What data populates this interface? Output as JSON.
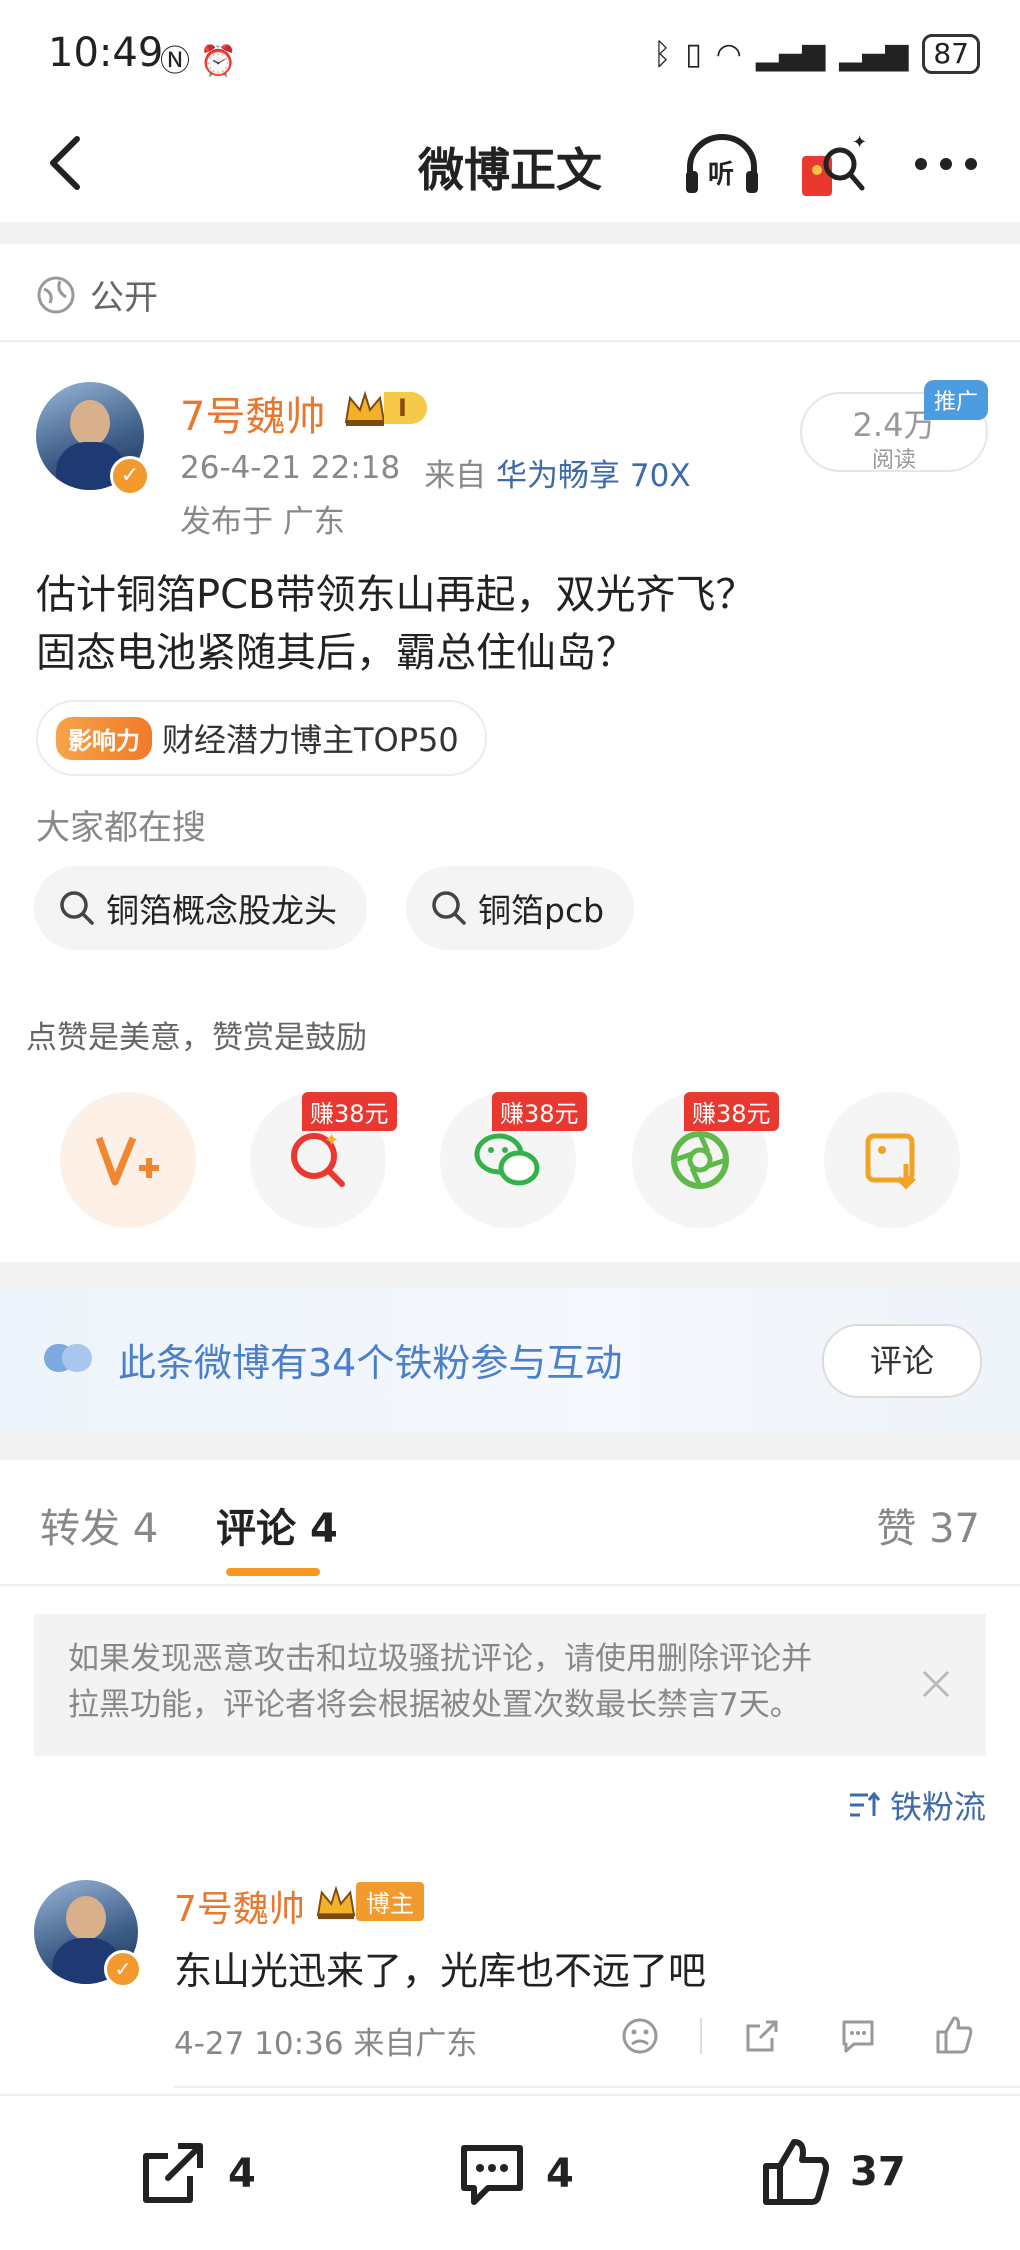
{
  "status_bar": {
    "time": "10:49",
    "battery": "87"
  },
  "nav": {
    "title": "微博正文",
    "listen_label": "听"
  },
  "visibility": {
    "label": "公开"
  },
  "author": {
    "name": "7号魏帅",
    "level": "I",
    "meta_time": "26-4-21 22:18",
    "meta_from": "来自",
    "device": "华为畅享 70X",
    "location": "发布于 广东"
  },
  "views": {
    "count": "2.4万",
    "label": "阅读",
    "promo": "推广"
  },
  "post": {
    "line1": "估计铜箔PCB带领东山再起，双光齐飞？",
    "line2": "固态电池紧随其后，霸总住仙岛？"
  },
  "influence": {
    "badge": "影响力",
    "text": "财经潜力博主TOP50"
  },
  "search": {
    "heading": "大家都在搜",
    "items": [
      "铜箔概念股龙头",
      "铜箔pcb"
    ]
  },
  "reward": {
    "hint": "点赞是美意，赞赏是鼓励",
    "earn_label": "赚38元"
  },
  "iron_fans": {
    "text": "此条微博有34个铁粉参与互动",
    "button": "评论"
  },
  "tabs": {
    "repost": "转发",
    "repost_count": "4",
    "comment": "评论",
    "comment_count": "4",
    "like": "赞",
    "like_count": "37"
  },
  "notice": {
    "line1": "如果发现恶意攻击和垃圾骚扰评论，请使用删除评论并",
    "line2": "拉黑功能，评论者将会根据被处置次数最长禁言7天。"
  },
  "fan_flow": {
    "label": "铁粉流"
  },
  "comment": {
    "name": "7号魏帅",
    "badge": "博主",
    "text": "东山光迅来了，光库也不远了吧",
    "meta": "4-27 10:36 来自广东"
  },
  "bottom_bar": {
    "repost_count": "4",
    "comment_count": "4",
    "like_count": "37"
  },
  "colors": {
    "accent": "#e8782f",
    "link": "#3d6aa8",
    "red": "#e8382f"
  }
}
